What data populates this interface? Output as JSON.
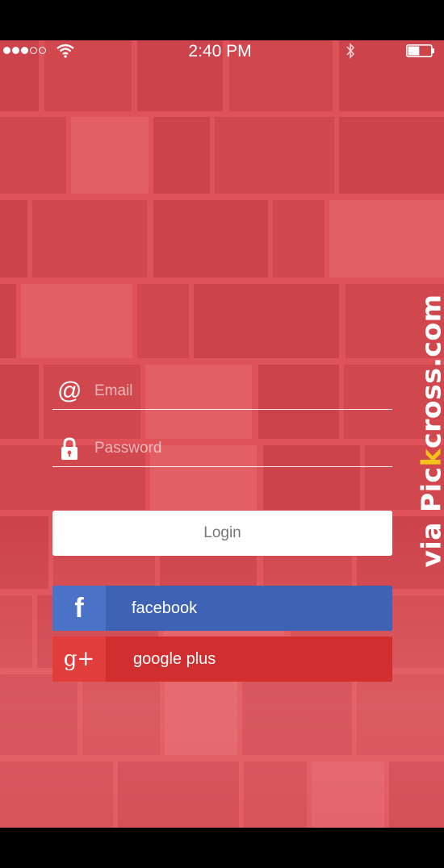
{
  "status_bar": {
    "time": "2:40 PM",
    "signal_bars_filled": 3,
    "signal_bars_total": 5,
    "wifi_icon": "wifi-icon",
    "bluetooth_icon": "bluetooth-icon",
    "battery_level": 0.5
  },
  "form": {
    "email": {
      "placeholder": "Email",
      "value": "",
      "icon": "at-icon"
    },
    "password": {
      "placeholder": "Password",
      "value": "",
      "icon": "lock-icon"
    },
    "login_label": "Login"
  },
  "social": {
    "facebook": {
      "label": "facebook",
      "icon_text": "f",
      "color": "#3f63b4"
    },
    "google": {
      "label": "google plus",
      "icon_text": "g+",
      "color": "#d12e2f"
    }
  },
  "watermark": {
    "prefix": "via Pic",
    "highlight": "k",
    "suffix": "cross.com"
  },
  "theme": {
    "background": "#e0525a",
    "highlight": "#f4c21a"
  }
}
